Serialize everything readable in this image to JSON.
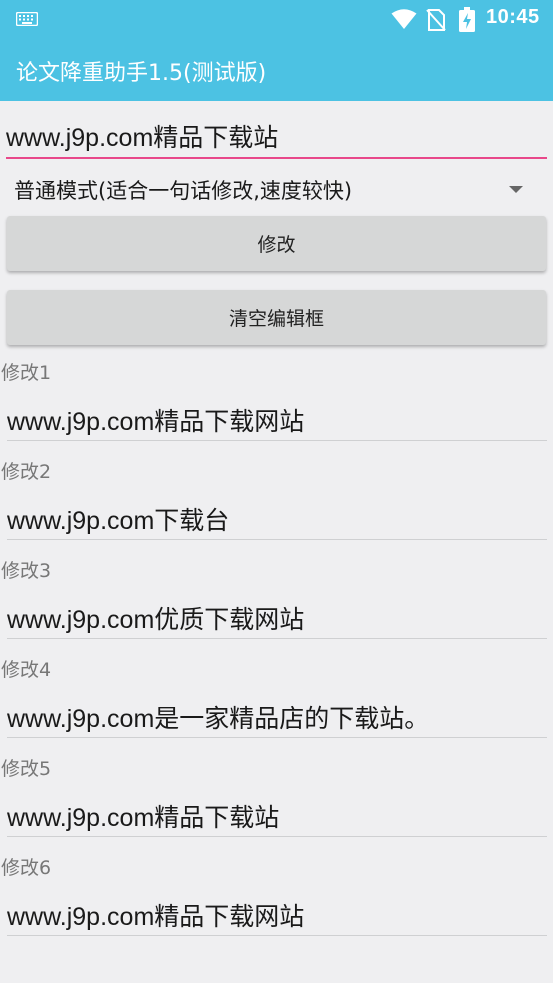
{
  "status_bar": {
    "time": "10:45",
    "icons": [
      "keyboard-icon",
      "wifi-icon",
      "no-sim-icon",
      "battery-charging-icon"
    ]
  },
  "app_bar": {
    "title": "论文降重助手1.5(测试版)"
  },
  "input": {
    "value": "www.j9p.com精品下载站"
  },
  "mode_spinner": {
    "selected": "普通模式(适合一句话修改,速度较快)"
  },
  "buttons": {
    "modify": "修改",
    "clear": "清空编辑框"
  },
  "results": [
    {
      "label": "修改1",
      "value": "www.j9p.com精品下载网站"
    },
    {
      "label": "修改2",
      "value": "www.j9p.com下载台"
    },
    {
      "label": "修改3",
      "value": "www.j9p.com优质下载网站"
    },
    {
      "label": "修改4",
      "value": "www.j9p.com是一家精品店的下载站。"
    },
    {
      "label": "修改5",
      "value": "www.j9p.com精品下载站"
    },
    {
      "label": "修改6",
      "value": "www.j9p.com精品下载网站"
    }
  ],
  "colors": {
    "primary": "#4cc2e3",
    "accent": "#e8488a",
    "background": "#efeff1",
    "button": "#d6d7d7"
  }
}
